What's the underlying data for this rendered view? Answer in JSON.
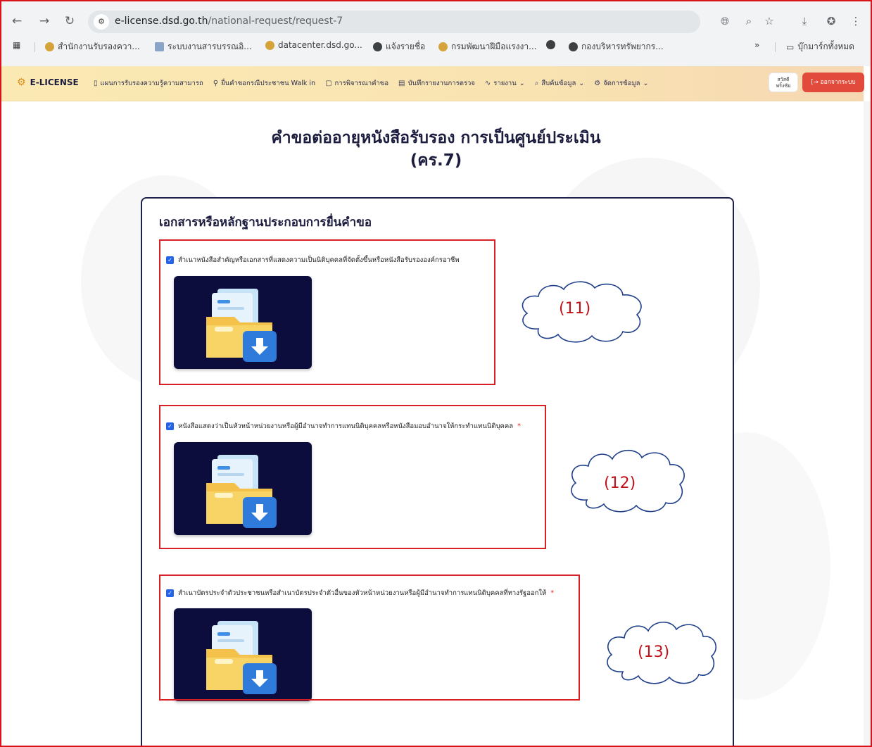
{
  "browser": {
    "url_host": "e-license.dsd.go.th",
    "url_path": "/national-request/request-7",
    "bookmarks": [
      "สำนักงานรับรองควา...",
      "ระบบงานสารบรรณอิ...",
      "datacenter.dsd.go...",
      "แจ้งรายชื่อ",
      "กรมพัฒนาฝีมือแรงงา...",
      "",
      "กองบริหารทรัพยากร..."
    ],
    "bookmarks_more": "»",
    "all_bookmarks": "บุ๊กมาร์กทั้งหมด"
  },
  "app": {
    "brand": "E-LICENSE",
    "nav": [
      "แผนการรับรองความรู้ความสามารถ",
      "ยื่นคำขอกรณีประชาชน Walk in",
      "การพิจารณาคำขอ",
      "บันทึกรายงานการตรวจ",
      "รายงาน",
      "สืบค้นข้อมูล",
      "จัดการข้อมูล"
    ],
    "greeting_line1": "สวัสดี",
    "greeting_line2": "พริ้งซัย",
    "logout": "ออกจากระบบ"
  },
  "page": {
    "title_line1": "คำขอต่ออายุหนังสือรับรอง การเป็นศูนย์ประเมิน",
    "title_line2": "(คร.7)",
    "section_title": "เอกสารหรือหลักฐานประกอบการยื่นคำขอ",
    "documents": [
      {
        "label": "สำเนาหนังสือสำคัญหรือเอกสารที่แสดงความเป็นนิติบุคคลที่จัดตั้งขึ้นหรือหนังสือรับรององค์กรอาชีพ",
        "required": "",
        "checked": true
      },
      {
        "label": "หนังสือแสดงว่าเป็นหัวหน้าหน่วยงานหรือผู้มีอำนาจทำการแทนนิติบุคคลหรือหนังสือมอบอำนาจให้กระทำแทนนิติบุคคล",
        "required": "*",
        "checked": true
      },
      {
        "label": "สำเนาบัตรประจำตัวประชาชนหรือสำเนาบัตรประจำตัวอื่นของหัวหน้าหน่วยงานหรือผู้มีอำนาจทำการแทนนิติบุคคลที่ทางรัฐออกให้",
        "required": "*",
        "checked": true
      }
    ]
  },
  "annotations": [
    "(11)",
    "(12)",
    "(13)"
  ],
  "colors": {
    "annotation_red": "#d81f26",
    "checkbox_blue": "#2563eb",
    "thumb_bg": "#0c0c3d",
    "logout_red": "#e24a3b",
    "title_navy": "#1c1d3e"
  },
  "icons": {
    "back": "arrow-left-icon",
    "forward": "arrow-right-icon",
    "reload": "reload-icon",
    "folder": "folder-download-icon",
    "checkbox": "checkbox-checked-icon",
    "cloud": "cloud-callout-icon"
  }
}
